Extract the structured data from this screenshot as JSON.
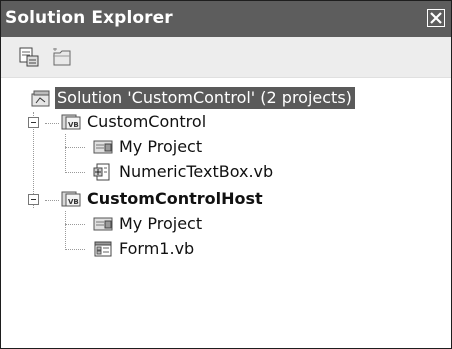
{
  "window": {
    "title": "Solution Explorer"
  },
  "toolbar": {
    "buttons": [
      {
        "icon": "properties-icon"
      },
      {
        "icon": "show-all-files-icon"
      }
    ]
  },
  "tree": {
    "solution": "Solution 'CustomControl' (2 projects)",
    "projects": [
      {
        "label": "CustomControl",
        "items": [
          {
            "label": "My Project",
            "icon": "my-project-icon"
          },
          {
            "label": "NumericTextBox.vb",
            "icon": "vb-class-file-icon"
          }
        ]
      },
      {
        "label": "CustomControlHost",
        "items": [
          {
            "label": "My Project",
            "icon": "my-project-icon"
          },
          {
            "label": "Form1.vb",
            "icon": "form-file-icon"
          }
        ]
      }
    ]
  }
}
